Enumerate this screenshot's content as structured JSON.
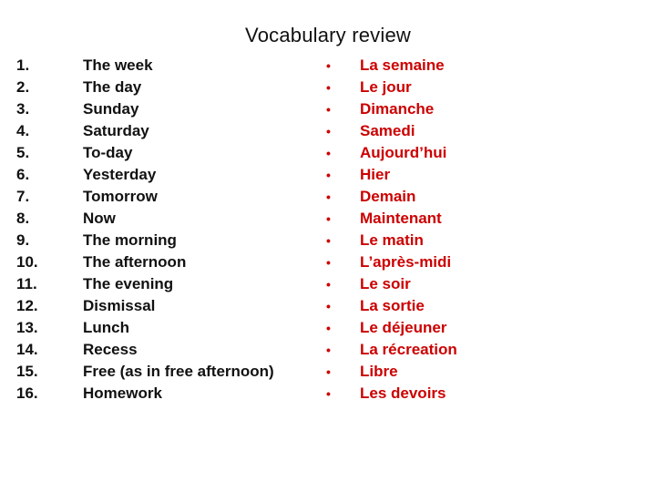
{
  "slide": {
    "title": "Vocabulary review",
    "colors": {
      "english_text": "#111111",
      "french_text": "#cc0000",
      "background": "#ffffff"
    },
    "bullet_glyph": "•",
    "items": [
      {
        "number": "1.",
        "english": "The week",
        "french": "La semaine"
      },
      {
        "number": "2.",
        "english": "The day",
        "french": "Le jour"
      },
      {
        "number": "3.",
        "english": "Sunday",
        "french": "Dimanche"
      },
      {
        "number": "4.",
        "english": "Saturday",
        "french": "Samedi"
      },
      {
        "number": "5.",
        "english": "To-day",
        "french": "Aujourd’hui"
      },
      {
        "number": "6.",
        "english": "Yesterday",
        "french": "Hier"
      },
      {
        "number": "7.",
        "english": "Tomorrow",
        "french": "Demain"
      },
      {
        "number": "8.",
        "english": "Now",
        "french": "Maintenant"
      },
      {
        "number": "9.",
        "english": "The morning",
        "french": "Le matin"
      },
      {
        "number": "10.",
        "english": "The afternoon",
        "french": "L’après-midi"
      },
      {
        "number": "11.",
        "english": "The evening",
        "french": "Le soir"
      },
      {
        "number": "12.",
        "english": "Dismissal",
        "french": "La sortie"
      },
      {
        "number": "13.",
        "english": "Lunch",
        "french": "Le déjeuner"
      },
      {
        "number": "14.",
        "english": "Recess",
        "french": "La récreation"
      },
      {
        "number": "15.",
        "english": "Free (as in free afternoon)",
        "french": "Libre"
      },
      {
        "number": "16.",
        "english": "Homework",
        "french": "Les devoirs"
      }
    ]
  }
}
